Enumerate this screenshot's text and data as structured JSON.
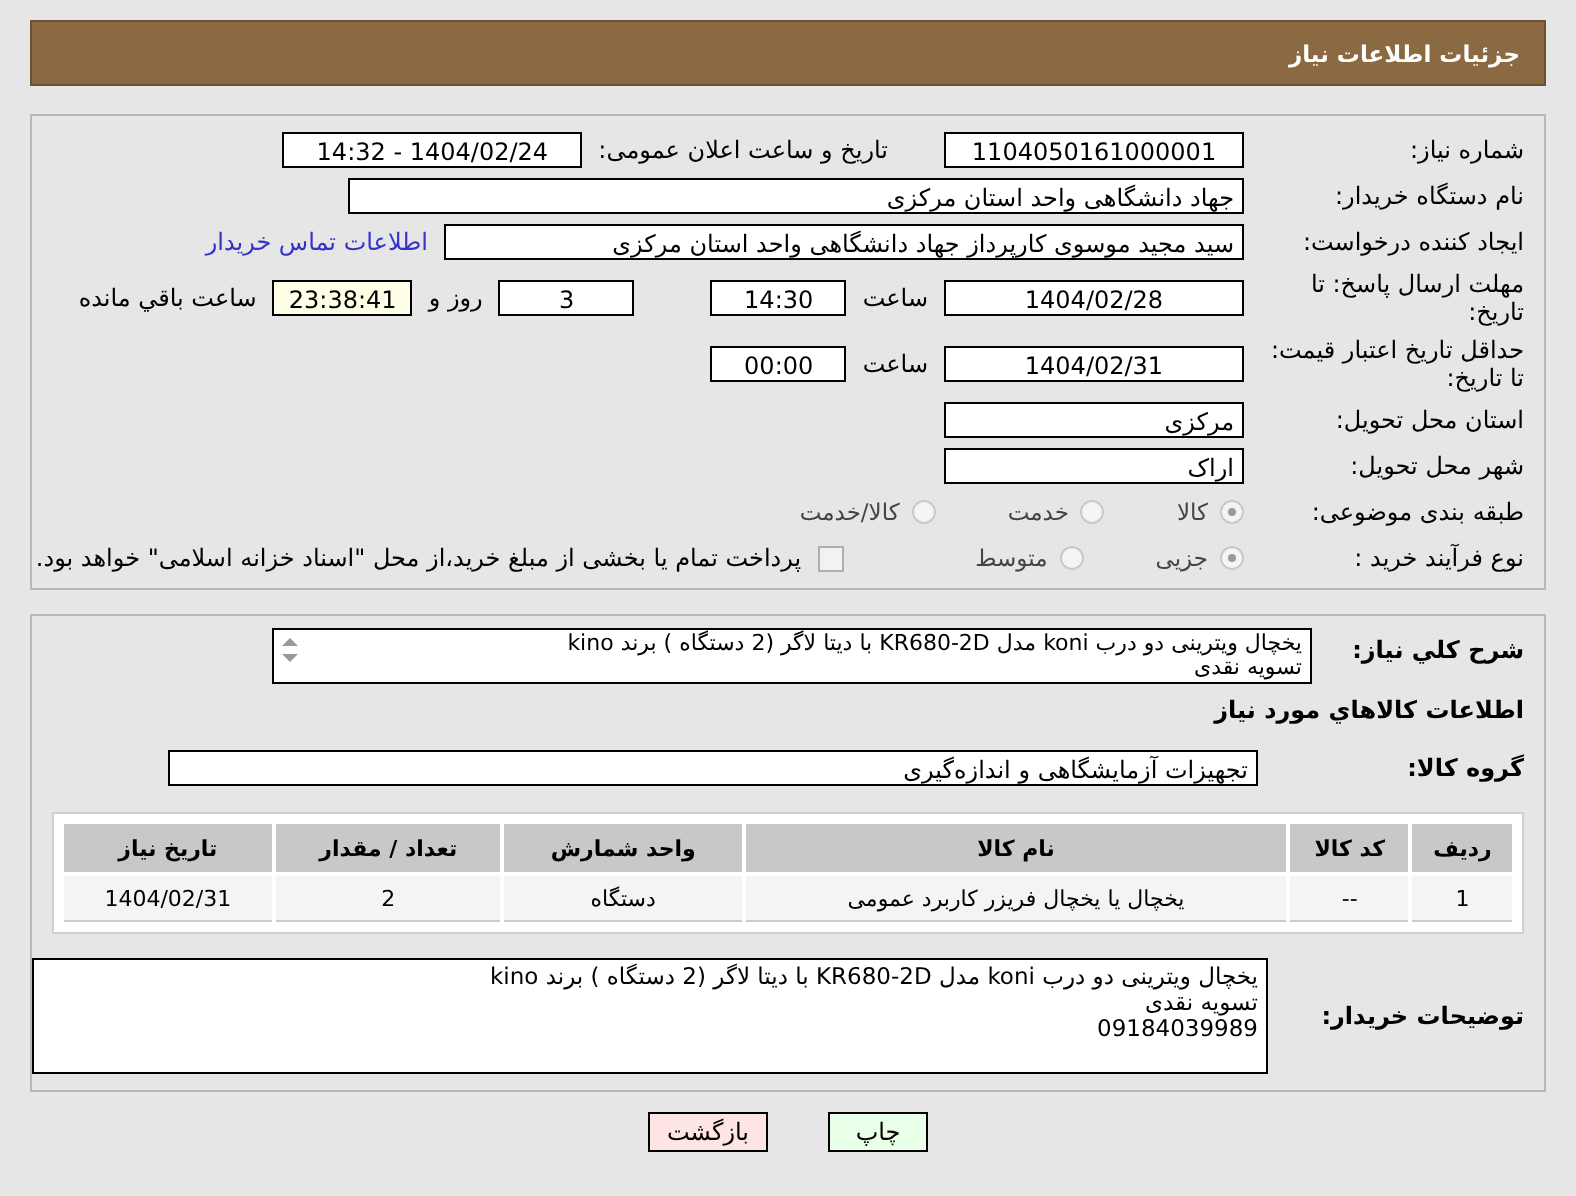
{
  "header": {
    "title": "جزئیات اطلاعات نیاز"
  },
  "form": {
    "need_number": {
      "label": "شماره نیاز:",
      "value": "1104050161000001"
    },
    "announce": {
      "label": "تاریخ و ساعت اعلان عمومی:",
      "value": "1404/02/24 - 14:32"
    },
    "buyer": {
      "label": "نام دستگاه خریدار:",
      "value": "جهاد دانشگاهی واحد استان مرکزی"
    },
    "creator": {
      "label": "ایجاد کننده درخواست:",
      "value": "سید مجید  موسوی  کارپرداز جهاد دانشگاهی واحد استان مرکزی",
      "link": "اطلاعات تماس خریدار"
    },
    "deadline": {
      "label": "مهلت ارسال پاسخ: تا تاریخ:",
      "date": "1404/02/28",
      "time_label": "ساعت",
      "time": "14:30",
      "days": "3",
      "days_label": "روز و",
      "remaining": "23:38:41",
      "remaining_label": "ساعت باقي مانده"
    },
    "validity": {
      "label": "حداقل تاریخ اعتبار قیمت: تا تاریخ:",
      "date": "1404/02/31",
      "time_label": "ساعت",
      "time": "00:00"
    },
    "province": {
      "label": "استان محل تحویل:",
      "value": "مرکزی"
    },
    "city": {
      "label": "شهر محل تحویل:",
      "value": "اراک"
    },
    "category": {
      "label": "طبقه بندی موضوعی:",
      "options": [
        {
          "label": "کالا",
          "selected": true
        },
        {
          "label": "خدمت",
          "selected": false
        },
        {
          "label": "کالا/خدمت",
          "selected": false
        }
      ]
    },
    "process": {
      "label": "نوع فرآیند خرید :",
      "options": [
        {
          "label": "جزیی",
          "selected": true
        },
        {
          "label": "متوسط",
          "selected": false
        }
      ],
      "payment": {
        "checked": false,
        "text": "پرداخت تمام یا بخشی از مبلغ خرید،از محل \"اسناد خزانه اسلامی\" خواهد بود."
      }
    }
  },
  "details": {
    "description": {
      "label": "شرح کلي نياز:",
      "text": "یخچال ویترینی دو درب koni مدل KR680-2D با دیتا لاگر (2 دستگاه )  برند kino\nتسویه نقدی"
    },
    "goods_title": "اطلاعات کالاهاي مورد نياز",
    "group": {
      "label": "گروه کالا:",
      "value": "تجهیزات آزمایشگاهی و اندازه‌گیری"
    },
    "table": {
      "columns": [
        "ردیف",
        "کد کالا",
        "نام کالا",
        "واحد شمارش",
        "تعداد / مقدار",
        "تاریخ نیاز"
      ],
      "rows": [
        [
          "1",
          "--",
          "یخچال یا یخچال فریزر کاربرد عمومی",
          "دستگاه",
          "2",
          "1404/02/31"
        ]
      ]
    },
    "buyer_notes": {
      "label": "توضیحات خریدار:",
      "text": "یخچال ویترینی دو درب koni مدل KR680-2D با دیتا لاگر (2 دستگاه )  برند kino\nتسویه نقدی\n09184039989"
    }
  },
  "buttons": [
    {
      "label": "چاپ",
      "kind": "print"
    },
    {
      "label": "بازگشت",
      "kind": "back"
    }
  ]
}
